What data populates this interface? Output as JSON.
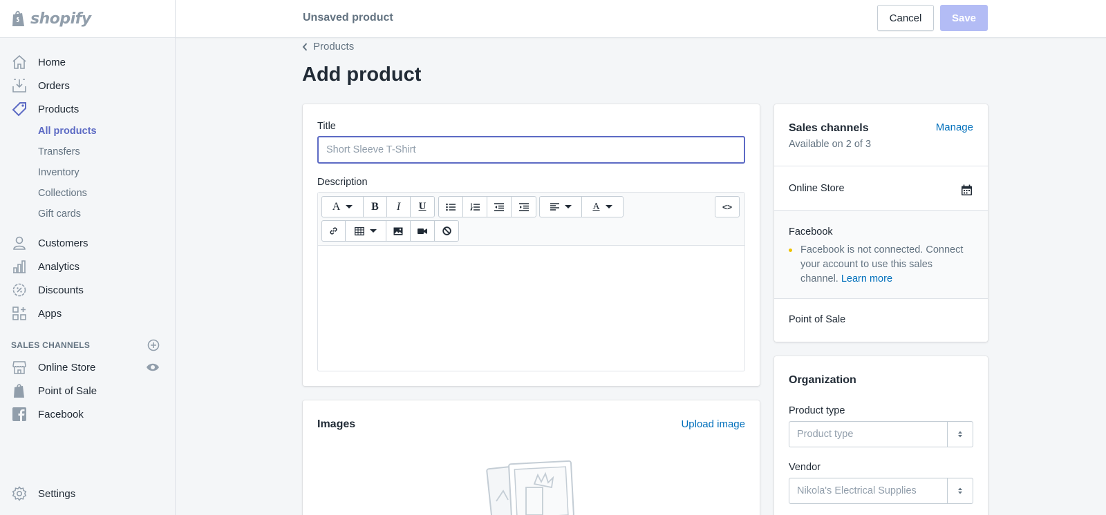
{
  "brand": {
    "name": "shopify"
  },
  "sidebar": {
    "items": [
      {
        "label": "Home",
        "icon": "home-icon"
      },
      {
        "label": "Orders",
        "icon": "orders-icon"
      },
      {
        "label": "Products",
        "icon": "tag-icon"
      }
    ],
    "products_sub": [
      "All products",
      "Transfers",
      "Inventory",
      "Collections",
      "Gift cards"
    ],
    "items2": [
      {
        "label": "Customers",
        "icon": "person-icon"
      },
      {
        "label": "Analytics",
        "icon": "bar-chart-icon"
      },
      {
        "label": "Discounts",
        "icon": "discount-icon"
      },
      {
        "label": "Apps",
        "icon": "apps-icon"
      }
    ],
    "sales_channels_heading": "SALES CHANNELS",
    "channels": [
      {
        "label": "Online Store",
        "icon": "store-icon"
      },
      {
        "label": "Point of Sale",
        "icon": "pos-bag-icon"
      },
      {
        "label": "Facebook",
        "icon": "facebook-icon"
      }
    ],
    "settings_label": "Settings"
  },
  "topbar": {
    "title": "Unsaved product",
    "cancel_label": "Cancel",
    "save_label": "Save"
  },
  "breadcrumb": {
    "label": "Products"
  },
  "page": {
    "title": "Add product"
  },
  "product_form": {
    "title_label": "Title",
    "title_placeholder": "Short Sleeve T-Shirt",
    "description_label": "Description",
    "toolbar": {
      "font_glyph": "A",
      "bold_glyph": "B",
      "italic_glyph": "I",
      "underline_glyph": "U",
      "color_glyph": "A",
      "code_glyph": "<>"
    }
  },
  "images": {
    "heading": "Images",
    "upload_label": "Upload image"
  },
  "sales_channels": {
    "heading": "Sales channels",
    "manage_label": "Manage",
    "availability": "Available on 2 of 3",
    "online_store": "Online Store",
    "facebook": "Facebook",
    "facebook_note": "Facebook is not connected. Connect your account to use this sales channel.",
    "learn_more": "Learn more",
    "pos": "Point of Sale"
  },
  "organization": {
    "heading": "Organization",
    "product_type_label": "Product type",
    "product_type_placeholder": "Product type",
    "vendor_label": "Vendor",
    "vendor_value": "Nikola's Electrical Supplies"
  },
  "colors": {
    "accent": "#5c6ac4",
    "link": "#006fbb",
    "save_disabled": "#b3bcf5",
    "warning_dot": "#eec200"
  }
}
